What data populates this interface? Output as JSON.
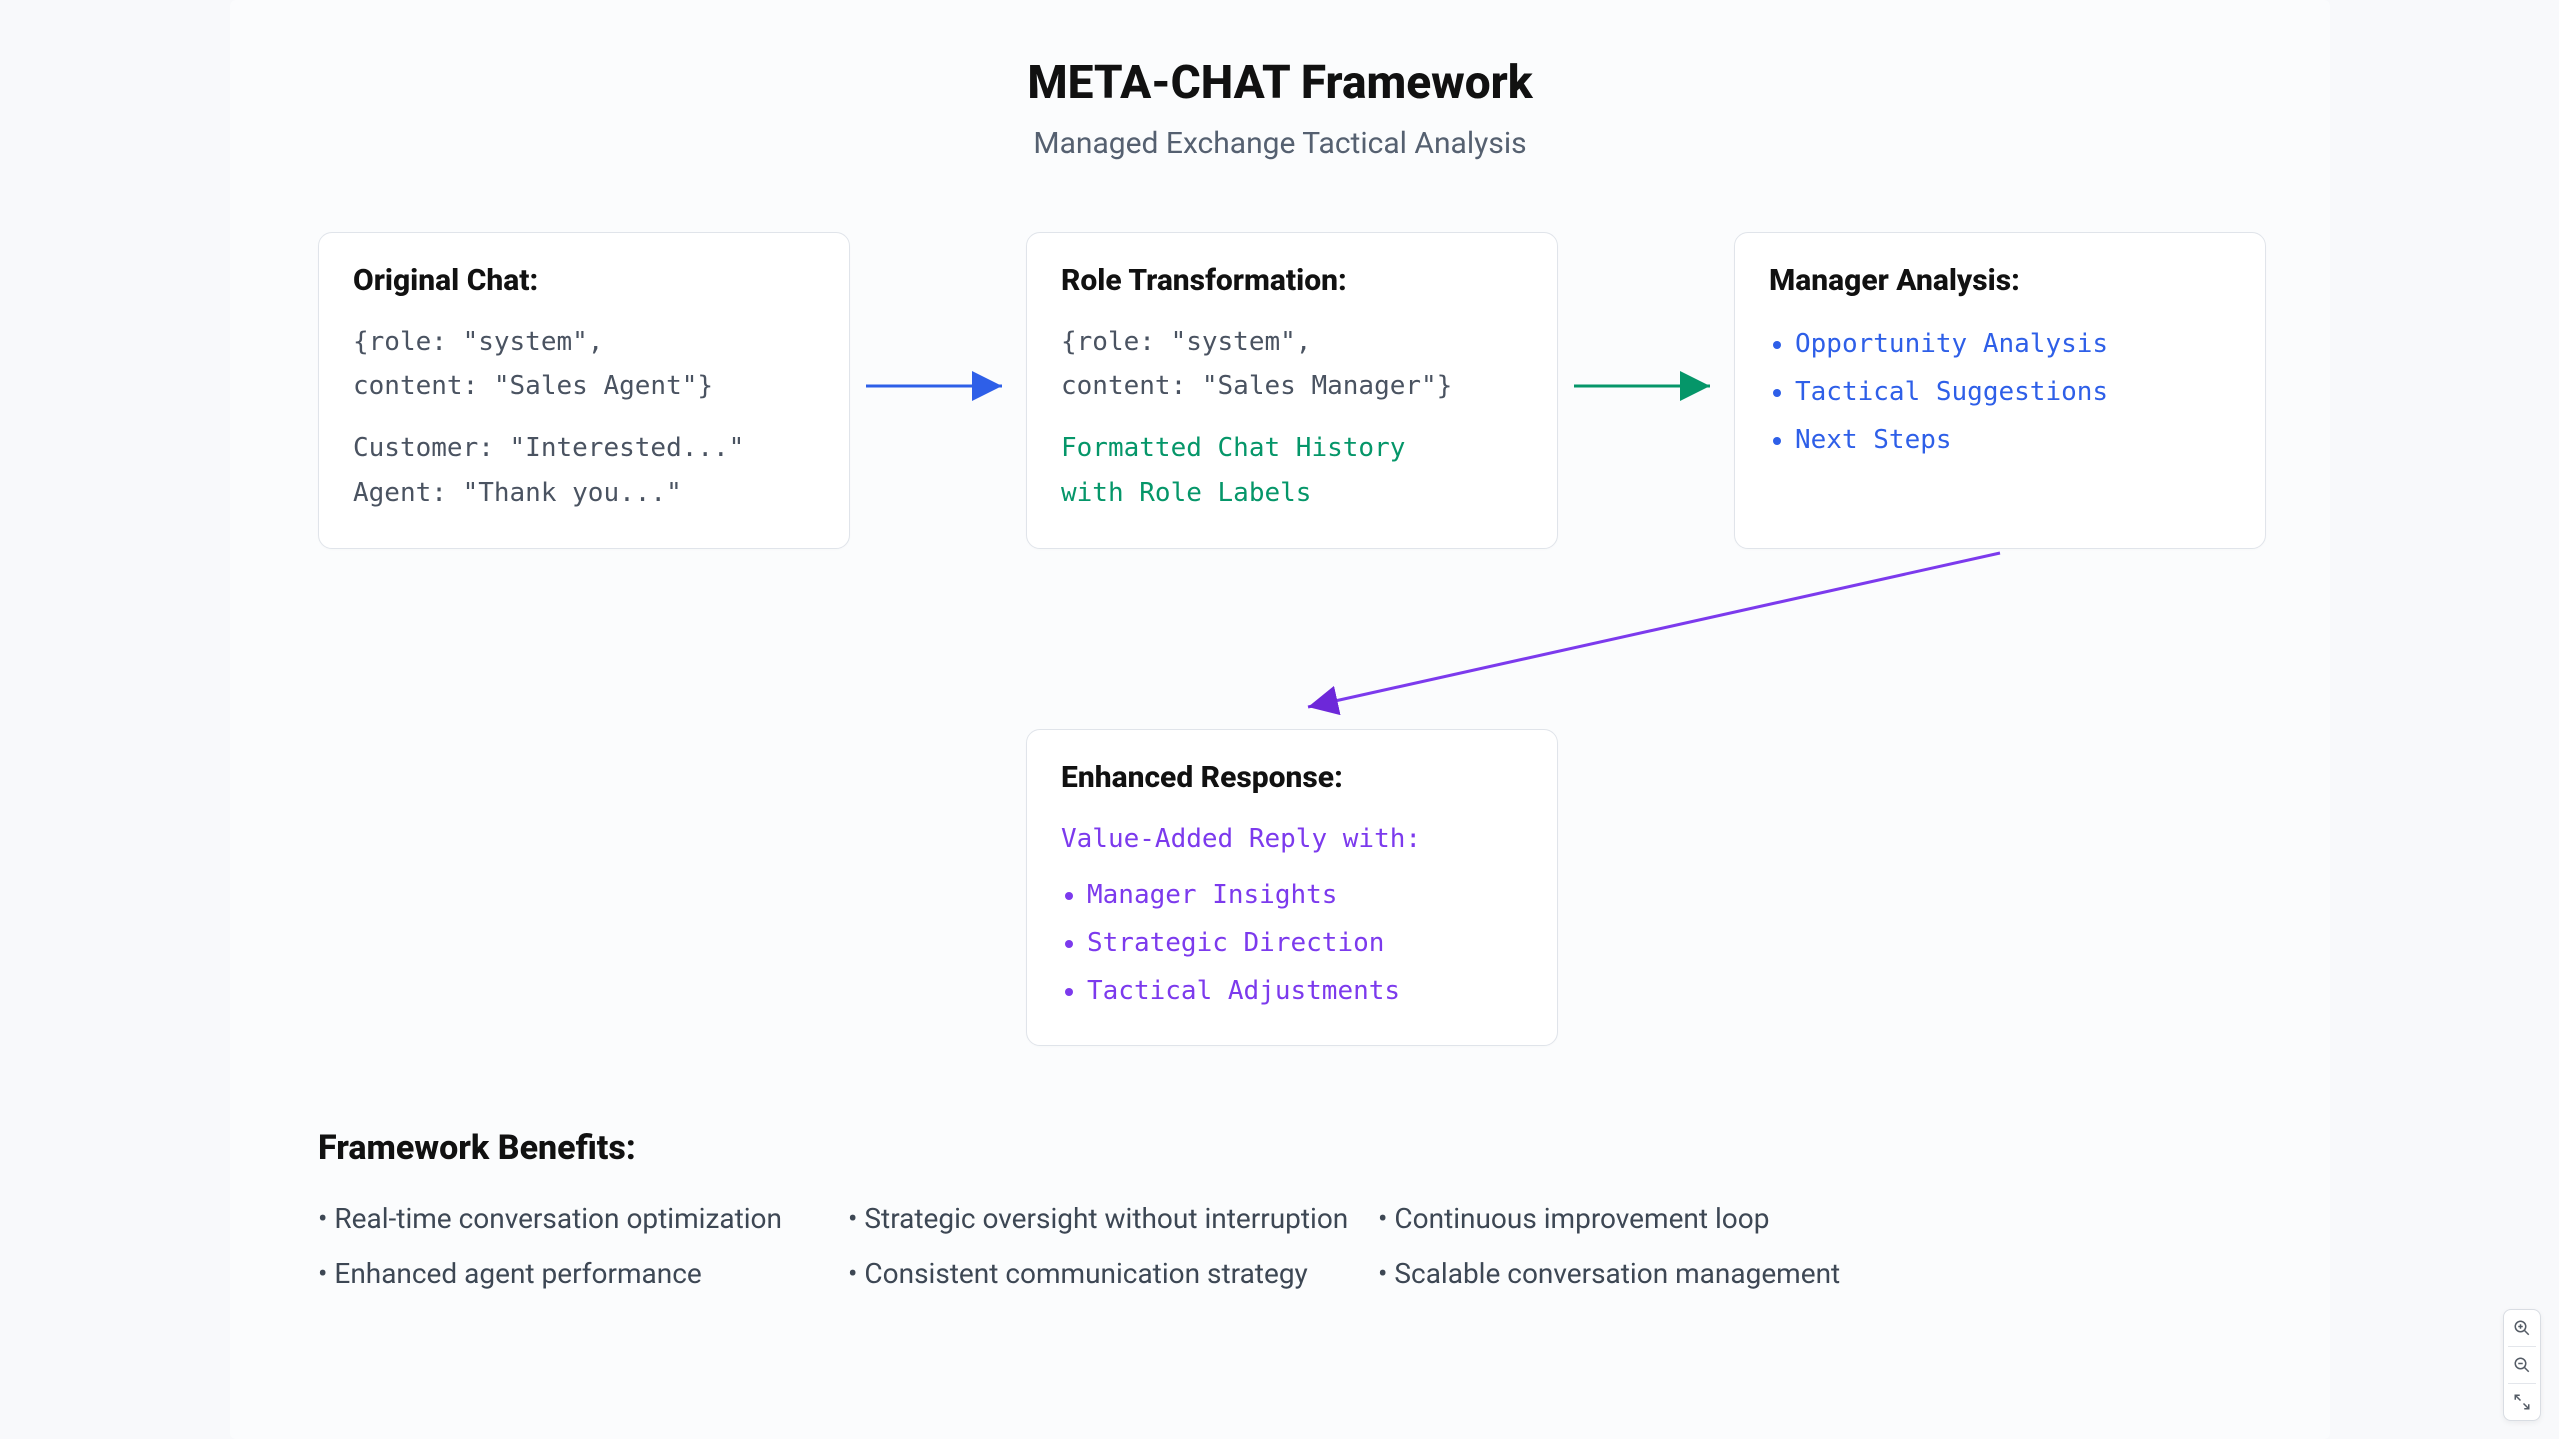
{
  "title": "META-CHAT Framework",
  "subtitle": "Managed Exchange Tactical Analysis",
  "colors": {
    "arrow1": "#2e5fe8",
    "arrow2": "#059669",
    "arrow3": "#7c3aed",
    "card_border": "#e0e4ea"
  },
  "cards": {
    "original": {
      "heading": "Original Chat:",
      "code1a": "{role: \"system\",",
      "code1b": "content: \"Sales Agent\"}",
      "code2a": "Customer: \"Interested...\"",
      "code2b": "Agent: \"Thank you...\""
    },
    "transform": {
      "heading": "Role Transformation:",
      "code1a": "{role: \"system\",",
      "code1b": "content: \"Sales Manager\"}",
      "green1": "Formatted Chat History",
      "green2": "with Role Labels"
    },
    "manager": {
      "heading": "Manager Analysis:",
      "items": [
        "Opportunity Analysis",
        "Tactical Suggestions",
        "Next Steps"
      ]
    },
    "enhanced": {
      "heading": "Enhanced Response:",
      "intro": "Value-Added Reply with:",
      "items": [
        "Manager Insights",
        "Strategic Direction",
        "Tactical Adjustments"
      ]
    }
  },
  "benefits": {
    "heading": "Framework Benefits:",
    "items": [
      "Real-time conversation optimization",
      "Strategic oversight without interruption",
      "Continuous improvement loop",
      "Enhanced agent performance",
      "Consistent communication strategy",
      "Scalable conversation management"
    ]
  }
}
